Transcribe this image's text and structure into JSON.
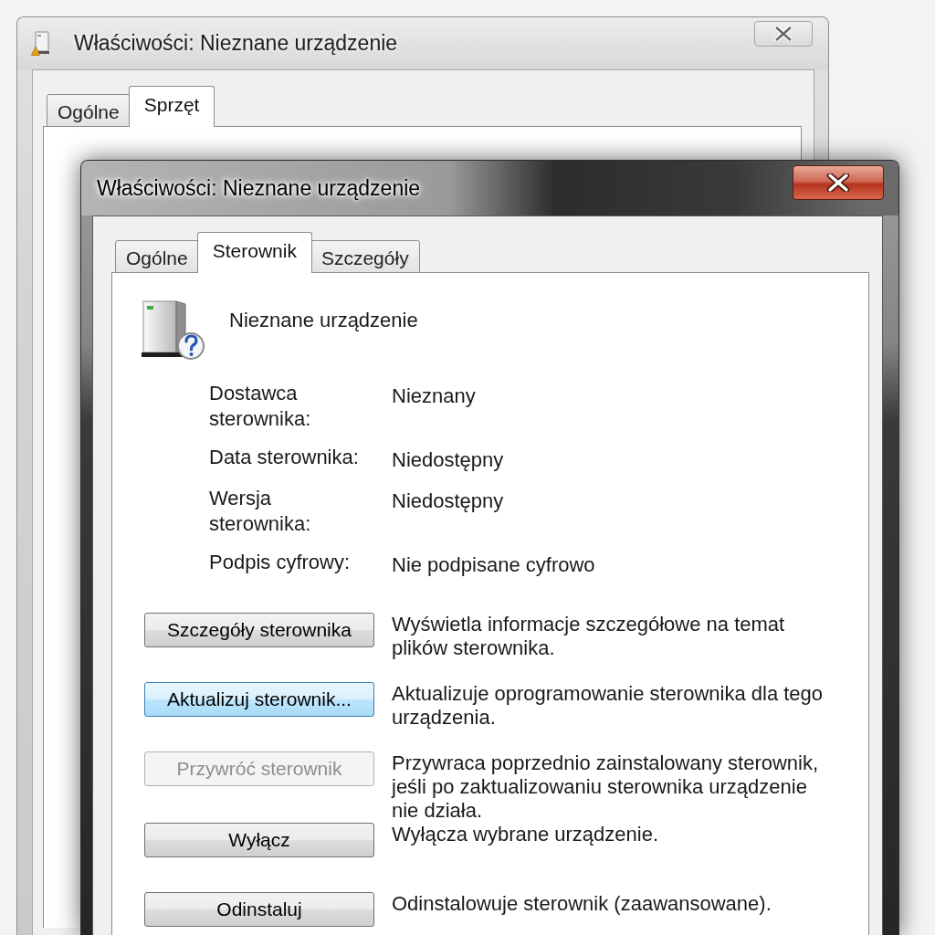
{
  "windows": [
    {
      "active": false,
      "title": "Właściwości: Nieznane urządzenie",
      "tabs": [
        {
          "label": "Ogólne",
          "selected": false
        },
        {
          "label": "Sprzęt",
          "selected": true
        }
      ]
    },
    {
      "active": true,
      "title": "Właściwości: Nieznane urządzenie",
      "tabs": [
        {
          "label": "Ogólne",
          "selected": false
        },
        {
          "label": "Sterownik",
          "selected": true
        },
        {
          "label": "Szczegóły",
          "selected": false
        }
      ],
      "device_name": "Nieznane urządzenie",
      "properties": [
        {
          "label": "Dostawca sterownika:",
          "value": "Nieznany"
        },
        {
          "label": "Data sterownika:",
          "value": "Niedostępny"
        },
        {
          "label": "Wersja sterownika:",
          "value": "Niedostępny"
        },
        {
          "label": "Podpis cyfrowy:",
          "value": "Nie podpisane cyfrowo"
        }
      ],
      "actions": [
        {
          "button": "Szczegóły sterownika",
          "hovered": false,
          "disabled": false,
          "description": "Wyświetla informacje szczegółowe na temat plików sterownika."
        },
        {
          "button": "Aktualizuj sterownik...",
          "hovered": true,
          "disabled": false,
          "description": "Aktualizuje oprogramowanie sterownika dla tego urządzenia."
        },
        {
          "button": "Przywróć sterownik",
          "hovered": false,
          "disabled": true,
          "description": "Przywraca poprzednio zainstalowany sterownik, jeśli po zaktualizowaniu sterownika urządzenie nie działa."
        },
        {
          "button": "Wyłącz",
          "hovered": false,
          "disabled": false,
          "description": "Wyłącza wybrane urządzenie."
        },
        {
          "button": "Odinstaluj",
          "hovered": false,
          "disabled": false,
          "description": "Odinstalowuje sterownik (zaawansowane)."
        }
      ]
    }
  ]
}
